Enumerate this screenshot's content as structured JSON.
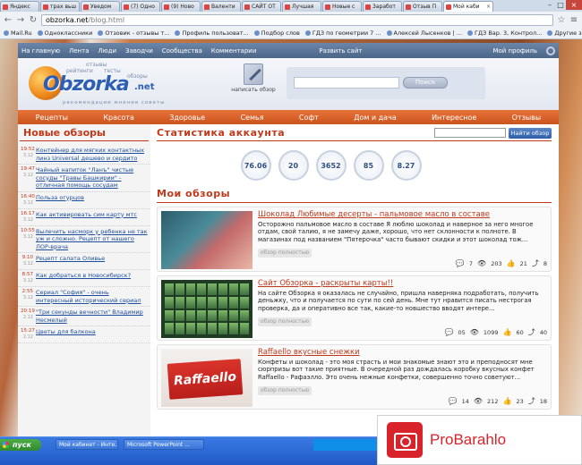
{
  "browser": {
    "tabs": [
      {
        "label": "Яндекс"
      },
      {
        "label": "трах вьш"
      },
      {
        "label": "Уведом"
      },
      {
        "label": "(7) Одно"
      },
      {
        "label": "(9) Ново"
      },
      {
        "label": "Валенти"
      },
      {
        "label": "САЙТ ОТ"
      },
      {
        "label": "Лучшая"
      },
      {
        "label": "Новые с"
      },
      {
        "label": "Заработ"
      },
      {
        "label": "Отзыв П"
      },
      {
        "label": "Мой каби",
        "active": true
      }
    ],
    "url_host": "obzorka.net",
    "url_path": "/blog.html",
    "bookmarks": [
      "Mail.Ru",
      "Одноклассники",
      "Отзовик - отзывы т...",
      "Профиль пользоват...",
      "Подбор слов",
      "ГДЗ по геометрии 7 ...",
      "Алексей Лысенков | ...",
      "ГДЗ Вар. 3, Контрол...",
      "Другие закладки"
    ]
  },
  "site": {
    "topnav": [
      "На главную",
      "Лента",
      "Люди",
      "Заводчи",
      "Сообщества",
      "Комментарии"
    ],
    "topnav_center": "Развить сайт",
    "topnav_right": "Мой профиль",
    "logo": {
      "word": "Obzorka",
      "net": ".net",
      "tag1": "отзывы",
      "tag2": "рейтинги",
      "tag3": "тесты",
      "tag4": "обзоры",
      "slogan": "рекомендации мнения советы"
    },
    "write_label": "написать обзор",
    "search_button": "Поиск",
    "categories": [
      "Рецепты",
      "Красота",
      "Здоровье",
      "Семья",
      "Софт",
      "Дом и дача",
      "Интересное",
      "Отзывы"
    ],
    "sidebar": {
      "title": "Новые обзоры",
      "items": [
        {
          "time": "19:52",
          "date": "3.12",
          "title": "Контейнер для мягких контактных линз Universal дешево и сердито"
        },
        {
          "time": "19:47",
          "date": "3.12",
          "title": "Чайный напиток \"Ланъ\" чистые сосуды \"Травы Башкирии\" - отличная помощь сосудам"
        },
        {
          "time": "16:40",
          "date": "3.12",
          "title": "Польза огурцов"
        },
        {
          "time": "16:17",
          "date": "3.12",
          "title": "Как активировать сим карту мтс"
        },
        {
          "time": "10:55",
          "date": "3.12",
          "title": "Вылечить насморк у ребенка не так уж и сложно. Рецепт от нашего ЛОР-врача"
        },
        {
          "time": "9:10",
          "date": "3.12",
          "title": "Рецепт салата Оливье"
        },
        {
          "time": "8:57",
          "date": "3.12",
          "title": "Как добраться в Новосибирск?"
        },
        {
          "time": "2:55",
          "date": "3.12",
          "title": "Сериал \"София\" - очень интересный исторический сериал"
        },
        {
          "time": "20:19",
          "date": "2.12",
          "title": "\"Три секунды вечности\" Владимир Несмелый"
        },
        {
          "time": "15:27",
          "date": "2.12",
          "title": "Цветы для балкона"
        }
      ]
    },
    "stats": {
      "title": "Статистика аккаунта",
      "search_button": "Найти обзор",
      "values": [
        "76.06",
        "20",
        "3652",
        "85",
        "8.27"
      ]
    },
    "reviews": {
      "title": "Мои обзоры",
      "more_label": "обзор полностью",
      "items": [
        {
          "title": "Шоколад Любимые десерты - пальмовое масло в составе",
          "text": "Осторожно пальмовое масло в составе Я люблю шоколад и наверное за него многое отдам, свой талию, я не замечу даже, хорошо, что нет склонности к полноте. В магазинах под названием \"Пятерочка\" часто бывают скидки и этот шоколад тож...",
          "comments": "7",
          "views": "203",
          "likes": "21",
          "shares": "8"
        },
        {
          "title": "Сайт Обзорка - раскрыты карты!!",
          "text": "На сайте Обзорка я оказалась не случайно, пришла наверняка подработать, получить деньжку, что и получается по сути по сей день. Мне тут нравится писать нестрогая проверка, да и оперативно все так, какие-то новшество вводят интере...",
          "comments": "05",
          "views": "1099",
          "likes": "60",
          "shares": "40"
        },
        {
          "title": "Raffaello вкусные снежки",
          "text": "Конфеты и шоколад - это моя страсть и мои знакомые знают это и преподносят мне сюрпризы вот такие приятные. В очередной раз дождалась коробку вкусных конфет Raffaello - Рафаэлло. Это очень нежные конфетки, совершенно точно советуют...",
          "comments": "14",
          "views": "212",
          "likes": "23",
          "shares": "18",
          "thumb_text": "Raffaello"
        }
      ]
    }
  },
  "taskbar": {
    "start": "пуск",
    "tasks": [
      "Мой кабинет - Инте...",
      "Microsoft PowerPoint ..."
    ]
  },
  "watermark": {
    "name": "ProBarahlo"
  }
}
